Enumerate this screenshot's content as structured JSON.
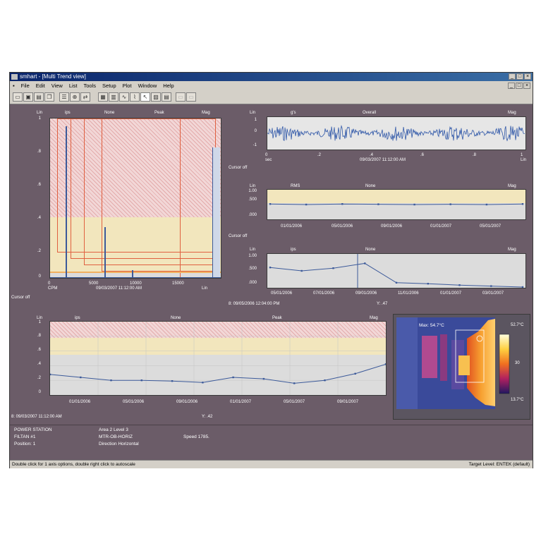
{
  "window": {
    "title": "smhart - [Multi Trend view]",
    "menu": [
      "File",
      "Edit",
      "View",
      "List",
      "Tools",
      "Setup",
      "Plot",
      "Window",
      "Help"
    ]
  },
  "colors": {
    "frame": "#6b5c68",
    "series_line": "#3c5a9a",
    "alarm_hatch": "#d07878",
    "alert_band": "#f2e6bd",
    "ok_band": "#dcdcdc",
    "marker": "#ff4a4a"
  },
  "spectrum": {
    "header": [
      "Lin",
      "ips",
      "None",
      "Peak",
      "Mag"
    ],
    "y_ticks": [
      "1",
      ".8",
      ".6",
      ".4",
      ".2",
      "0"
    ],
    "x_ticks": [
      "0",
      "5000",
      "10000",
      "15000"
    ],
    "x_unit": "CPM",
    "x_end": "Lin",
    "timestamp": "09/03/2007 11:12:00 AM",
    "cursor": "Cursor off",
    "alarm_band_top": 0.62,
    "alert_band_top": 0.04,
    "peaks": [
      {
        "x": 0.09,
        "level": 0.95
      },
      {
        "x": 0.32,
        "level": 0.32
      },
      {
        "x": 0.48,
        "level": 0.05
      }
    ]
  },
  "waveform": {
    "header": [
      "Lin",
      "g's",
      "Overall",
      "Mag"
    ],
    "y_ticks": [
      "1",
      "0",
      "-1"
    ],
    "x_ticks": [
      "0",
      ".2",
      ".4",
      ".6",
      ".8",
      "1"
    ],
    "x_unit": "sec",
    "x_end": "Lin",
    "timestamp": "09/03/2007 11:12:00 AM",
    "cursor": "Cursor off"
  },
  "trend1": {
    "header": [
      "Lin",
      "RMS",
      "None",
      "Mag"
    ],
    "y_ticks": [
      "1.00",
      ".500",
      ".000"
    ],
    "x_ticks": [
      "01/01/2006",
      "05/01/2006",
      "09/01/2006",
      "01/01/2007",
      "05/01/2007"
    ],
    "cursor": "Cursor off",
    "values": [
      0.52,
      0.5,
      0.52,
      0.51,
      0.5,
      0.51,
      0.5,
      0.52
    ]
  },
  "trend2": {
    "header": [
      "Lin",
      "ips",
      "None",
      "Mag"
    ],
    "y_ticks": [
      "1.00",
      ".500",
      ".000"
    ],
    "x_ticks": [
      "05/01/2006",
      "07/01/2006",
      "09/01/2006",
      "11/01/2006",
      "01/01/2007",
      "03/01/2007"
    ],
    "readout": "8: 09/05/2006 12:04:00 PM",
    "readout_value": "Y: .47",
    "values": [
      0.6,
      0.5,
      0.58,
      0.72,
      0.15,
      0.12,
      0.08,
      0.05,
      0.02
    ]
  },
  "trend3": {
    "header": [
      "Lin",
      "ips",
      "None",
      "Peak",
      "Mag"
    ],
    "y_ticks": [
      "1",
      ".8",
      ".6",
      ".4",
      ".2",
      "0"
    ],
    "x_ticks": [
      "01/01/2006",
      "05/01/2006",
      "09/01/2006",
      "01/01/2007",
      "05/01/2007",
      "09/01/2007"
    ],
    "readout": "8: 09/03/2007 11:12:00 AM",
    "readout_value": "Y: .42",
    "alarm_level": 0.78,
    "alert_level": 0.55,
    "values": [
      0.28,
      0.24,
      0.2,
      0.2,
      0.19,
      0.17,
      0.24,
      0.22,
      0.16,
      0.2,
      0.29,
      0.42
    ]
  },
  "thermal": {
    "max_label": "Max: 54.7°C",
    "scale_max": "52.7°C",
    "scale_mid": "30",
    "scale_min": "13.7°C"
  },
  "info": {
    "site": "POWER STATION",
    "machine": "FILTAN #1",
    "position": "Position: 1",
    "area": "Area 2 Level 3",
    "point": "MTR-OB-HORIZ",
    "direction": "Direction Horizontal",
    "speed": "Speed 1785.",
    "speed_unit": ""
  },
  "status": {
    "left": "Double click for 1 axis options, double right click to autoscale",
    "right": "Target Level: ENTEK     (default)"
  }
}
